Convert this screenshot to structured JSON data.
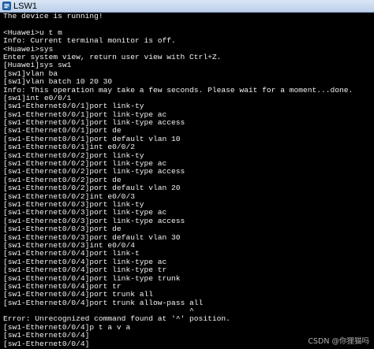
{
  "window": {
    "title": "LSW1"
  },
  "terminal": {
    "lines": [
      "The device is running!",
      "",
      "<Huawei>u t m",
      "Info: Current terminal monitor is off.",
      "<Huawei>sys",
      "Enter system view, return user view with Ctrl+Z.",
      "[Huawei]sys sw1",
      "[sw1]vlan ba",
      "[sw1]vlan batch 10 20 30",
      "Info: This operation may take a few seconds. Please wait for a moment...done.",
      "[sw1]int e0/0/1",
      "[sw1-Ethernet0/0/1]port link-ty",
      "[sw1-Ethernet0/0/1]port link-type ac",
      "[sw1-Ethernet0/0/1]port link-type access",
      "[sw1-Ethernet0/0/1]port de",
      "[sw1-Ethernet0/0/1]port default vlan 10",
      "[sw1-Ethernet0/0/1]int e0/0/2",
      "[sw1-Ethernet0/0/2]port link-ty",
      "[sw1-Ethernet0/0/2]port link-type ac",
      "[sw1-Ethernet0/0/2]port link-type access",
      "[sw1-Ethernet0/0/2]port de",
      "[sw1-Ethernet0/0/2]port default vlan 20",
      "[sw1-Ethernet0/0/2]int e0/0/3",
      "[sw1-Ethernet0/0/3]port link-ty",
      "[sw1-Ethernet0/0/3]port link-type ac",
      "[sw1-Ethernet0/0/3]port link-type access",
      "[sw1-Ethernet0/0/3]port de",
      "[sw1-Ethernet0/0/3]port default vlan 30",
      "[sw1-Ethernet0/0/3]int e0/0/4",
      "[sw1-Ethernet0/0/4]port link-t",
      "[sw1-Ethernet0/0/4]port link-type ac",
      "[sw1-Ethernet0/0/4]port link-type tr",
      "[sw1-Ethernet0/0/4]port link-type trunk",
      "[sw1-Ethernet0/0/4]port tr",
      "[sw1-Ethernet0/0/4]port trunk all",
      "[sw1-Ethernet0/0/4]port trunk allow-pass all",
      "                                         ^",
      "Error: Unrecognized command found at '^' position.",
      "[sw1-Ethernet0/0/4]p t a v a",
      "[sw1-Ethernet0/0/4]",
      "[sw1-Ethernet0/0/4]"
    ]
  },
  "watermark": {
    "text": "CSDN @你狸猫吗"
  },
  "colors": {
    "terminal_bg": "#000000",
    "terminal_fg": "#f2f2f2",
    "titlebar_bg": "#c9dbf1"
  },
  "icons": {
    "app": "terminal-app-icon"
  }
}
